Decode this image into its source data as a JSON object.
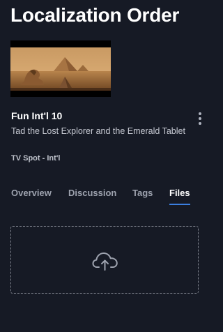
{
  "page": {
    "title": "Localization Order"
  },
  "asset": {
    "thumbnail_icon": "video-thumbnail",
    "title": "Fun Int'l 10",
    "subtitle": "Tad the Lost Explorer and the Emerald Tablet",
    "type": "TV Spot - Int'l",
    "menu_icon": "more-vertical-icon"
  },
  "tabs": [
    {
      "label": "Overview",
      "active": false
    },
    {
      "label": "Discussion",
      "active": false
    },
    {
      "label": "Tags",
      "active": false
    },
    {
      "label": "Files",
      "active": true
    }
  ],
  "files": {
    "dropzone_icon": "cloud-upload-icon"
  },
  "colors": {
    "background": "#161a25",
    "accent": "#3b7fe0",
    "text": "#ffffff",
    "muted_text": "#9da2ae"
  }
}
